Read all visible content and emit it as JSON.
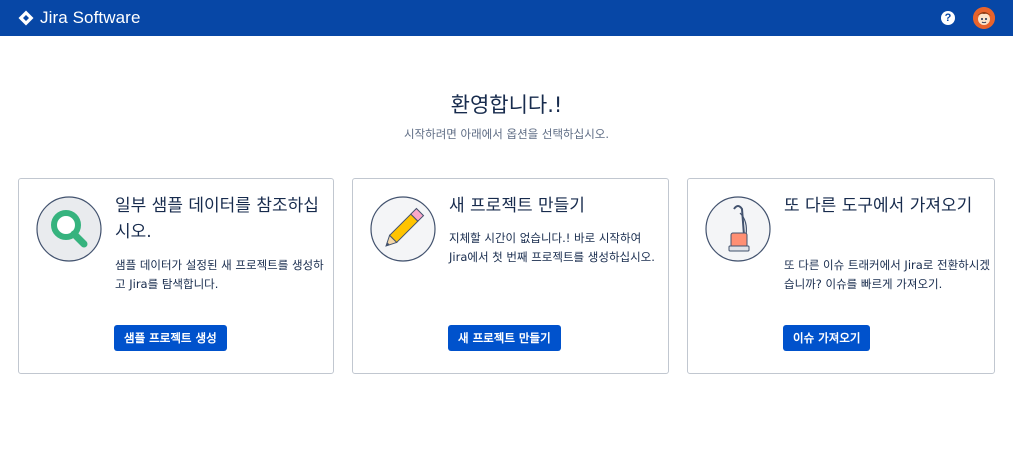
{
  "header": {
    "app_name": "Jira Software",
    "help_label": "?",
    "colors": {
      "bar": "#0747a6",
      "button": "#0052cc"
    }
  },
  "main": {
    "title": "환영합니다.!",
    "subtitle": "시작하려면 아래에서 옵션을 선택하십시오."
  },
  "cards": [
    {
      "icon": "magnifier-icon",
      "title": "일부 샘플 데이터를 참조하십시오.",
      "description": "샘플 데이터가 설정된 새 프로젝트를 생성하고 Jira를 탐색합니다.",
      "button": "샘플 프로젝트 생성"
    },
    {
      "icon": "pencil-icon",
      "title": "새 프로젝트 만들기",
      "description": "지체할 시간이 없습니다.! 바로 시작하여 Jira에서 첫 번째 프로젝트를 생성하십시오.",
      "button": "새 프로젝트 만들기"
    },
    {
      "icon": "vacuum-icon",
      "title": "또 다른 도구에서 가져오기",
      "description": "또 다른 이슈 트래커에서 Jira로 전환하시겠습니까? 이슈를 빠르게 가져오기.",
      "button": "이슈 가져오기"
    }
  ]
}
